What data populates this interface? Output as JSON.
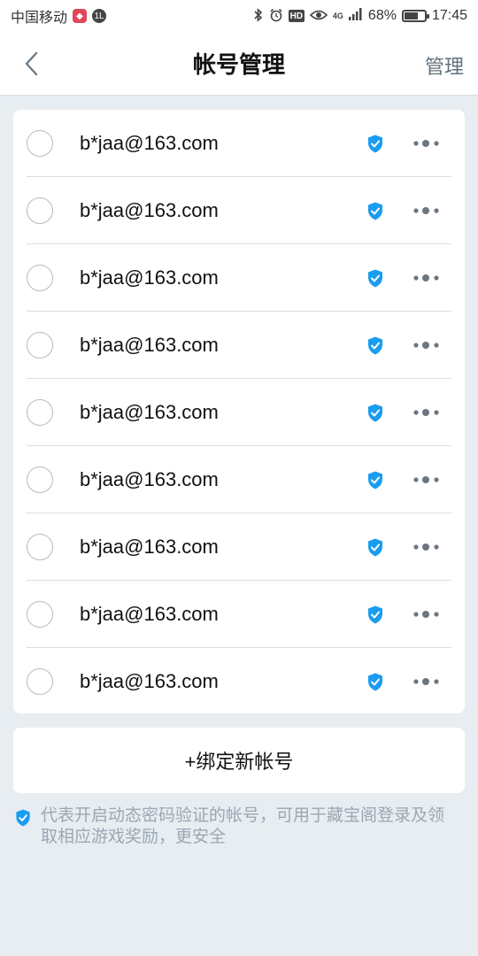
{
  "status_bar": {
    "carrier": "中国移动",
    "app_badge": "◆",
    "circle_badge": "1L",
    "icons": [
      "bluetooth-icon",
      "alarm-icon",
      "hd-icon",
      "eye-icon",
      "4g-icon",
      "signal-icon"
    ],
    "hd_label": "HD",
    "network_label": "4G",
    "battery_percent": "68%",
    "battery_level": 0.68,
    "time": "17:45"
  },
  "header": {
    "title": "帐号管理",
    "manage_label": "管理"
  },
  "accounts": [
    {
      "email": "b*jaa@163.com",
      "verified": true
    },
    {
      "email": "b*jaa@163.com",
      "verified": true
    },
    {
      "email": "b*jaa@163.com",
      "verified": true
    },
    {
      "email": "b*jaa@163.com",
      "verified": true
    },
    {
      "email": "b*jaa@163.com",
      "verified": true
    },
    {
      "email": "b*jaa@163.com",
      "verified": true
    },
    {
      "email": "b*jaa@163.com",
      "verified": true
    },
    {
      "email": "b*jaa@163.com",
      "verified": true
    },
    {
      "email": "b*jaa@163.com",
      "verified": true
    }
  ],
  "bind_button_label": "+绑定新帐号",
  "footnote": "代表开启动态密码验证的帐号，可用于藏宝阁登录及领取相应游戏奖励，更安全",
  "colors": {
    "accent_blue": "#1a9cf0",
    "background": "#e8edf1",
    "footnote_text": "#9aa8b4"
  }
}
